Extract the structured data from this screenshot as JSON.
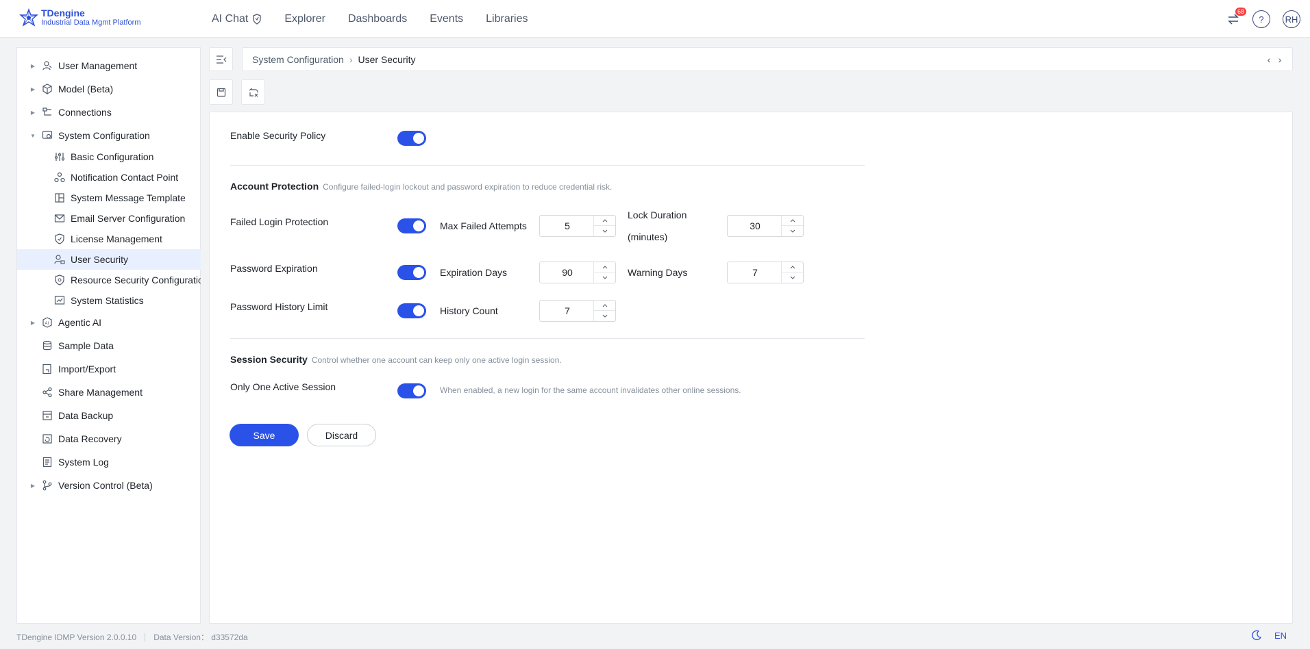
{
  "app": {
    "name": "TDengine",
    "subtitle": "Industrial Data Mgmt Platform"
  },
  "nav": {
    "items": [
      "AI Chat",
      "Explorer",
      "Dashboards",
      "Events",
      "Libraries"
    ]
  },
  "topright": {
    "notification_count": "68",
    "help": "?",
    "avatar_initials": "RH"
  },
  "sidebar": {
    "items": [
      {
        "label": "User Management",
        "icon": "users-icon"
      },
      {
        "label": "Model (Beta)",
        "icon": "cube-icon"
      },
      {
        "label": "Connections",
        "icon": "connections-icon"
      },
      {
        "label": "System Configuration",
        "icon": "system-config-icon"
      },
      {
        "label": "Basic Configuration",
        "icon": "sliders-icon"
      },
      {
        "label": "Notification Contact Point",
        "icon": "contact-point-icon"
      },
      {
        "label": "System Message Template",
        "icon": "template-icon"
      },
      {
        "label": "Email Server Configuration",
        "icon": "mail-icon"
      },
      {
        "label": "License Management",
        "icon": "shield-check-icon"
      },
      {
        "label": "User Security",
        "icon": "user-lock-icon"
      },
      {
        "label": "Resource Security Configuration",
        "icon": "shield-icon"
      },
      {
        "label": "System Statistics",
        "icon": "stats-icon"
      },
      {
        "label": "Agentic AI",
        "icon": "ai-icon"
      },
      {
        "label": "Sample Data",
        "icon": "database-icon"
      },
      {
        "label": "Import/Export",
        "icon": "import-export-icon"
      },
      {
        "label": "Share Management",
        "icon": "share-icon"
      },
      {
        "label": "Data Backup",
        "icon": "backup-icon"
      },
      {
        "label": "Data Recovery",
        "icon": "recovery-icon"
      },
      {
        "label": "System Log",
        "icon": "log-icon"
      },
      {
        "label": "Version Control (Beta)",
        "icon": "branch-icon"
      }
    ]
  },
  "breadcrumb": {
    "parent": "System Configuration",
    "current": "User Security"
  },
  "form": {
    "enable_security_policy": {
      "label": "Enable Security Policy",
      "enabled": true
    },
    "account_protection": {
      "title": "Account Protection",
      "desc": "Configure failed-login lockout and password expiration to reduce credential risk."
    },
    "failed_login": {
      "label": "Failed Login Protection",
      "enabled": true,
      "max_attempts_label": "Max Failed Attempts",
      "max_attempts": "5",
      "lock_duration_label_1": "Lock Duration",
      "lock_duration_label_2": "(minutes)",
      "lock_duration": "30"
    },
    "password_expiration": {
      "label": "Password Expiration",
      "enabled": true,
      "expiration_days_label": "Expiration Days",
      "expiration_days": "90",
      "warning_days_label": "Warning Days",
      "warning_days": "7"
    },
    "password_history": {
      "label": "Password History Limit",
      "enabled": true,
      "history_count_label": "History Count",
      "history_count": "7"
    },
    "session_security": {
      "title": "Session Security",
      "desc": "Control whether one account can keep only one active login session."
    },
    "one_active_session": {
      "label": "Only One Active Session",
      "enabled": true,
      "hint": "When enabled, a new login for the same account invalidates other online sessions."
    },
    "save": "Save",
    "discard": "Discard"
  },
  "footer": {
    "version": "TDengine IDMP Version 2.0.0.10",
    "data_version": "Data Version： d33572da",
    "lang": "EN"
  },
  "colors": {
    "primary": "#2b52e8",
    "brand": "#2b4fd8",
    "active_bg": "#e8f0ff",
    "badge": "#f53f3f"
  }
}
